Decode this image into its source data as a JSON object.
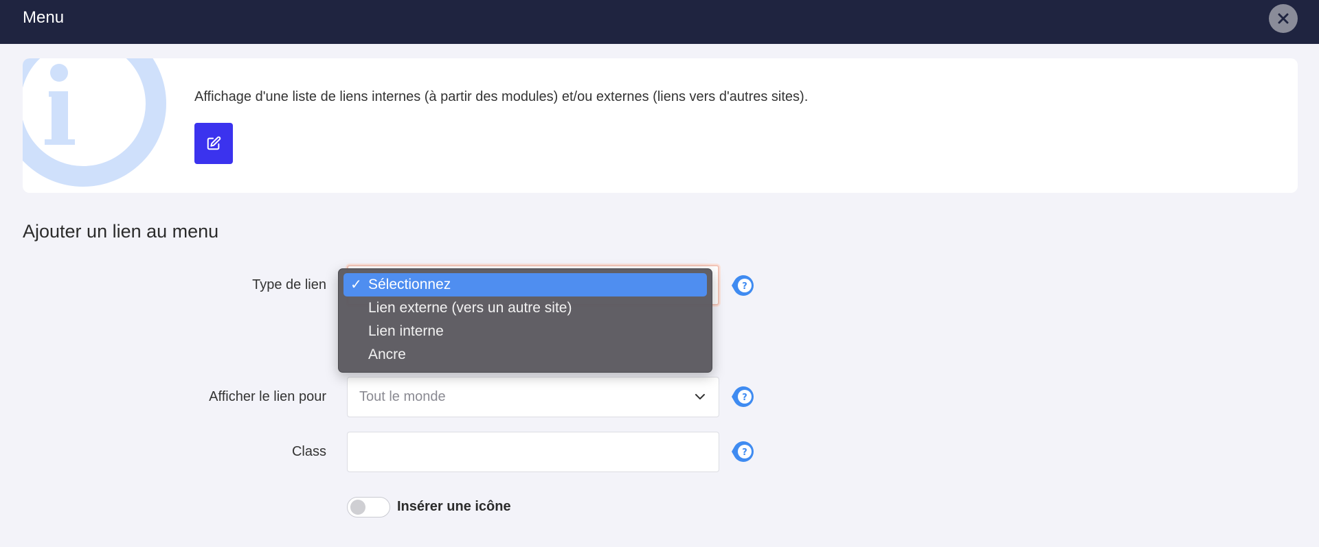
{
  "header": {
    "title": "Menu"
  },
  "info": {
    "description": "Affichage d'une liste de liens internes (à partir des modules) et/ou externes (liens vers d'autres sites)."
  },
  "form": {
    "section_title": "Ajouter un lien au menu",
    "type_label": "Type de lien",
    "type_options": [
      "Sélectionnez",
      "Lien externe (vers un autre site)",
      "Lien interne",
      "Ancre"
    ],
    "type_selected": "Sélectionnez",
    "show_label": "Afficher le lien pour",
    "show_value": "Tout le monde",
    "class_label": "Class",
    "class_value": "",
    "icon_toggle_label": "Insérer une icône",
    "icon_toggle_on": false
  },
  "colors": {
    "topbar": "#1f2440",
    "accent": "#3b33ee",
    "help_icon": "#3f8bf1",
    "dropdown_highlight": "#4f8ef0"
  },
  "icons": {
    "close": "close-icon",
    "info": "info-icon",
    "edit": "edit-icon",
    "help": "help-icon",
    "chevron": "chevron-down-icon",
    "check": "check-icon"
  }
}
